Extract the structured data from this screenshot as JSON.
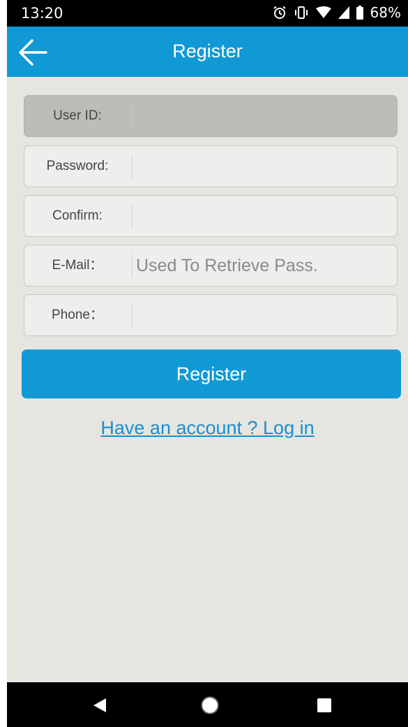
{
  "status_bar": {
    "time": "13:20",
    "battery": "68%",
    "icons": [
      "alarm-icon",
      "vibrate-icon",
      "wifi-icon",
      "signal-icon",
      "battery-icon"
    ]
  },
  "app_bar": {
    "title": "Register",
    "back_icon": "arrow-left-icon"
  },
  "form": {
    "fields": [
      {
        "label": "User ID:",
        "value": "",
        "placeholder": "",
        "disabled": true
      },
      {
        "label": "Password:",
        "value": "",
        "placeholder": ""
      },
      {
        "label": "Confirm:",
        "value": "",
        "placeholder": ""
      },
      {
        "label": "E-Mail：",
        "value": "",
        "placeholder": "Used To Retrieve Pass."
      },
      {
        "label": "Phone：",
        "value": "",
        "placeholder": ""
      }
    ],
    "register_label": "Register",
    "login_link": "Have an account ? Log in"
  },
  "nav_bar": {
    "icons": [
      "back-triangle-icon",
      "home-circle-icon",
      "recents-square-icon"
    ]
  },
  "colors": {
    "accent": "#1199d6",
    "background": "#e6e5e0",
    "field": "#eeeeec",
    "field_disabled": "#bcbcb8",
    "link": "#1a8fd0"
  }
}
